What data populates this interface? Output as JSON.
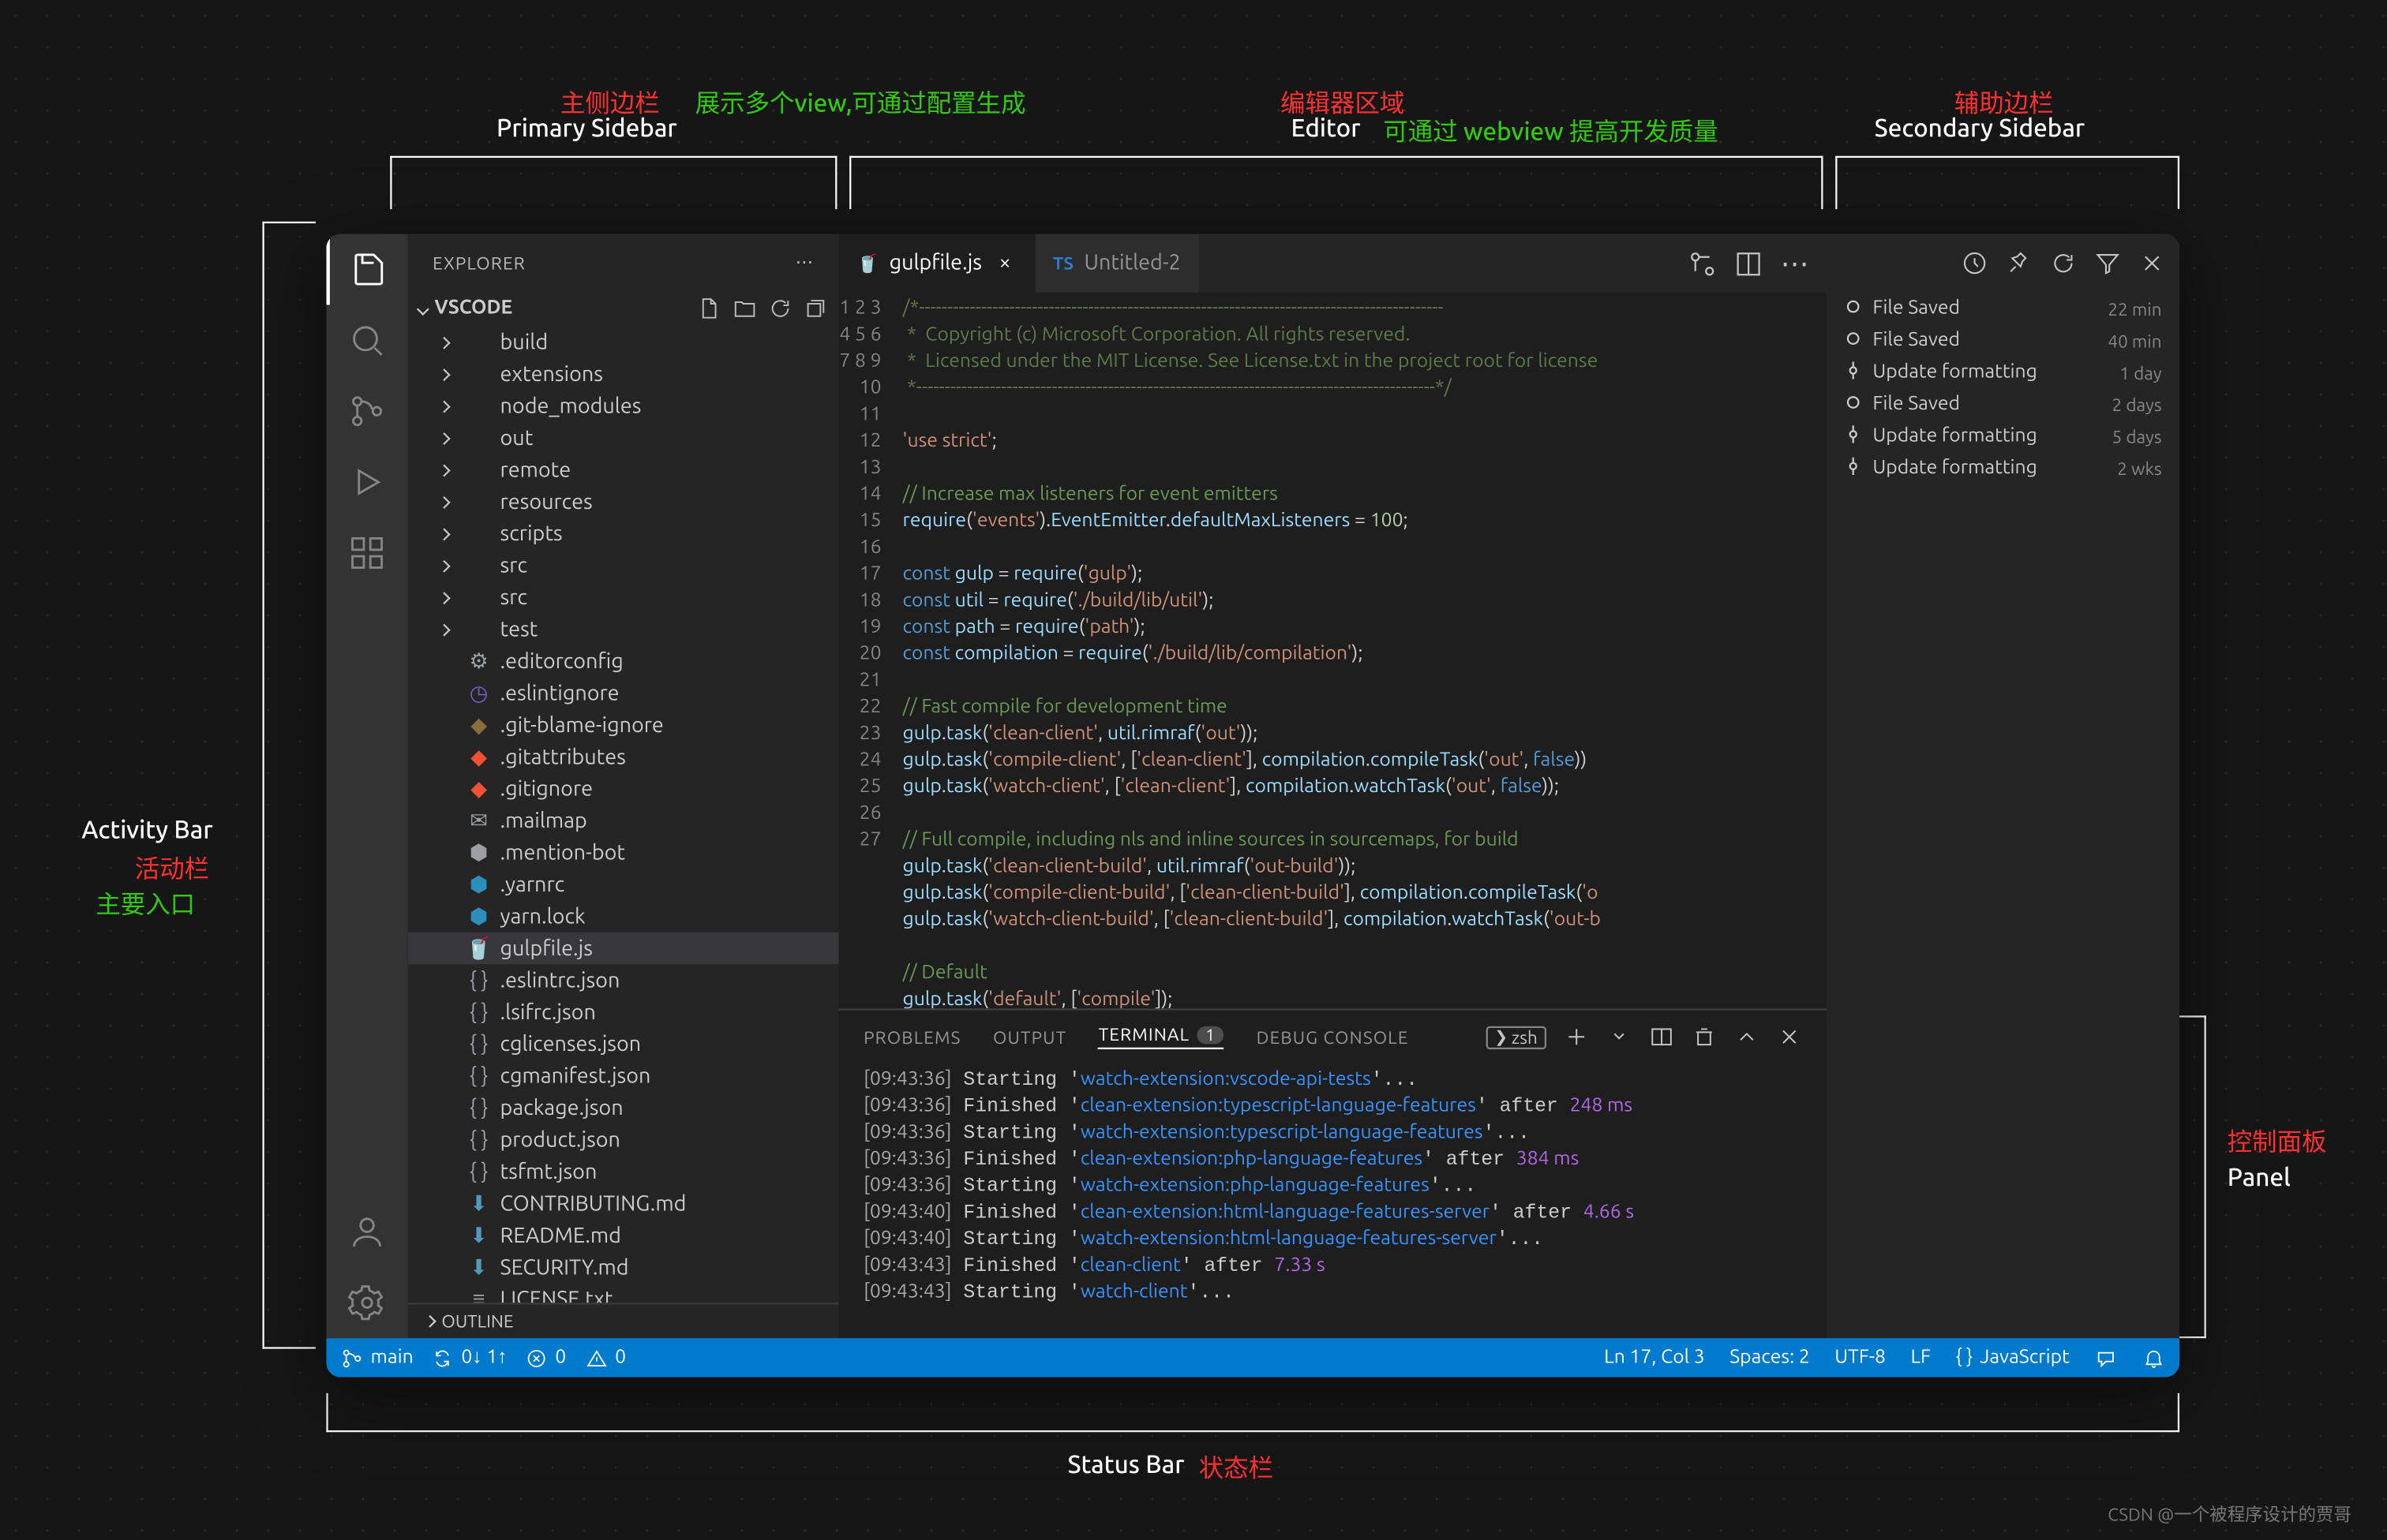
{
  "labels": {
    "primary_cn": "主侧边栏",
    "primary_en": "Primary Sidebar",
    "primary_view": "展示多个view,可通过配置生成",
    "editor_cn": "编辑器区域",
    "editor_en": "Editor",
    "editor_tip": "可通过 webview 提高开发质量",
    "secondary_cn": "辅助边栏",
    "secondary_en": "Secondary Sidebar",
    "activity_en": "Activity Bar",
    "activity_cn": "活动栏",
    "activity_tip": "主要入口",
    "panel_cn": "控制面板",
    "panel_en": "Panel",
    "status_en": "Status Bar",
    "status_cn": "状态栏"
  },
  "sidebar": {
    "title": "EXPLORER",
    "section": "VSCODE",
    "outline": "OUTLINE",
    "tree": [
      {
        "name": "build",
        "type": "folder"
      },
      {
        "name": "extensions",
        "type": "folder"
      },
      {
        "name": "node_modules",
        "type": "folder"
      },
      {
        "name": "out",
        "type": "folder"
      },
      {
        "name": "remote",
        "type": "folder"
      },
      {
        "name": "resources",
        "type": "folder"
      },
      {
        "name": "scripts",
        "type": "folder"
      },
      {
        "name": "src",
        "type": "folder"
      },
      {
        "name": "src",
        "type": "folder"
      },
      {
        "name": "test",
        "type": "folder"
      },
      {
        "name": ".editorconfig",
        "type": "file",
        "icon": "⚙",
        "ic": "#9aa0a6"
      },
      {
        "name": ".eslintignore",
        "type": "file",
        "icon": "◷",
        "ic": "#7b5fd1"
      },
      {
        "name": ".git-blame-ignore",
        "type": "file",
        "icon": "◆",
        "ic": "#8a6d3b"
      },
      {
        "name": ".gitattributes",
        "type": "file",
        "icon": "◆",
        "ic": "#f05133"
      },
      {
        "name": ".gitignore",
        "type": "file",
        "icon": "◆",
        "ic": "#f05133"
      },
      {
        "name": ".mailmap",
        "type": "file",
        "icon": "✉",
        "ic": "#9aa0a6"
      },
      {
        "name": ".mention-bot",
        "type": "file",
        "icon": "⬢",
        "ic": "#9aa0a6"
      },
      {
        "name": ".yarnrc",
        "type": "file",
        "icon": "⬢",
        "ic": "#2c8ebb"
      },
      {
        "name": "yarn.lock",
        "type": "file",
        "icon": "⬢",
        "ic": "#2c8ebb"
      },
      {
        "name": "gulpfile.js",
        "type": "file",
        "icon": "🥤",
        "ic": "#eb4a4b",
        "active": true
      },
      {
        "name": ".eslintrc.json",
        "type": "file",
        "icon": "{ }",
        "ic": "#9aa0a6"
      },
      {
        "name": ".lsifrc.json",
        "type": "file",
        "icon": "{ }",
        "ic": "#9aa0a6"
      },
      {
        "name": "cglicenses.json",
        "type": "file",
        "icon": "{ }",
        "ic": "#9aa0a6"
      },
      {
        "name": "cgmanifest.json",
        "type": "file",
        "icon": "{ }",
        "ic": "#9aa0a6"
      },
      {
        "name": "package.json",
        "type": "file",
        "icon": "{ }",
        "ic": "#9aa0a6"
      },
      {
        "name": "product.json",
        "type": "file",
        "icon": "{ }",
        "ic": "#9aa0a6"
      },
      {
        "name": "tsfmt.json",
        "type": "file",
        "icon": "{ }",
        "ic": "#9aa0a6"
      },
      {
        "name": "CONTRIBUTING.md",
        "type": "file",
        "icon": "⬇",
        "ic": "#519aba"
      },
      {
        "name": "README.md",
        "type": "file",
        "icon": "⬇",
        "ic": "#519aba"
      },
      {
        "name": "SECURITY.md",
        "type": "file",
        "icon": "⬇",
        "ic": "#519aba"
      },
      {
        "name": "LICENSE.txt",
        "type": "file",
        "icon": "≡",
        "ic": "#9aa0a6"
      }
    ]
  },
  "tabs": [
    {
      "icon": "🥤",
      "label": "gulpfile.js",
      "active": true
    },
    {
      "icon": "TS",
      "label": "Untitled-2"
    }
  ],
  "secondary": {
    "items": [
      {
        "label": "File Saved",
        "time": "22 min",
        "icon": "dot"
      },
      {
        "label": "File Saved",
        "time": "40 min",
        "icon": "dot"
      },
      {
        "label": "Update formatting",
        "time": "1 day",
        "icon": "commit"
      },
      {
        "label": "File Saved",
        "time": "2 days",
        "icon": "dot"
      },
      {
        "label": "Update formatting",
        "time": "5 days",
        "icon": "commit"
      },
      {
        "label": "Update formatting",
        "time": "2 wks",
        "icon": "commit"
      }
    ]
  },
  "panel": {
    "tabs": [
      "PROBLEMS",
      "OUTPUT",
      "TERMINAL",
      "DEBUG CONSOLE"
    ],
    "active": 2,
    "badge": "1",
    "shell": "zsh"
  },
  "statusbar": {
    "branch": "main",
    "sync": "0↓ 1↑",
    "errors": "0",
    "warnings": "0",
    "cursor": "Ln 17, Col 3",
    "spaces": "Spaces: 2",
    "encoding": "UTF-8",
    "eol": "LF",
    "lang": "JavaScript"
  },
  "watermark": "CSDN @一个被程序设计的贾哥"
}
